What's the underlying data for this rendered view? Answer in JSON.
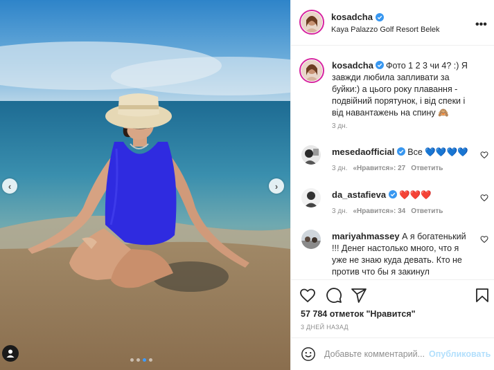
{
  "post": {
    "username": "kosadcha",
    "location": "Kaya Palazzo Golf Resort Belek"
  },
  "caption": {
    "username": "kosadcha",
    "text": "Фото 1 2 3 чи 4? :) Я завжди любила запливати за буйки:) а цього року плавання - подвійний порятунок, і від спеки і від навантажень на спину 🙈",
    "time": "3 дн."
  },
  "comments": [
    {
      "username": "mesedaofficial",
      "verified": true,
      "text": "Все",
      "emoji": "💙💙💙💙",
      "time": "3 дн.",
      "likes": "«Нравится»: 27",
      "reply": "Ответить"
    },
    {
      "username": "da_astafieva",
      "verified": true,
      "text": "",
      "emoji": "❤️❤️❤️",
      "time": "3 дн.",
      "likes": "«Нравится»: 34",
      "reply": "Ответить"
    },
    {
      "username": "mariyahmassey",
      "verified": false,
      "text": "А я богатенький !!! Денег настолько много, что я уже не знаю куда девать. Кто не против что бы я закинул",
      "emoji": "",
      "time": "",
      "likes": "",
      "reply": ""
    }
  ],
  "stats": {
    "likes": "57 784 отметок \"Нравится\"",
    "posted": "3 ДНЕЙ НАЗАД"
  },
  "add_comment": {
    "placeholder": "Добавьте комментарий...",
    "publish": "Опубликовать"
  },
  "carousel": {
    "count": 4,
    "active": 3
  },
  "colors": {
    "verified": "#3897f0",
    "link": "#b2dffc",
    "swimsuit": "#2f2be0",
    "sea": "#2e7ea6"
  },
  "icons": [
    "chevron-left-icon",
    "chevron-right-icon",
    "user-tag-icon",
    "more-icon",
    "heart-icon",
    "comment-icon",
    "share-icon",
    "bookmark-icon",
    "emoji-icon",
    "verified-icon"
  ]
}
